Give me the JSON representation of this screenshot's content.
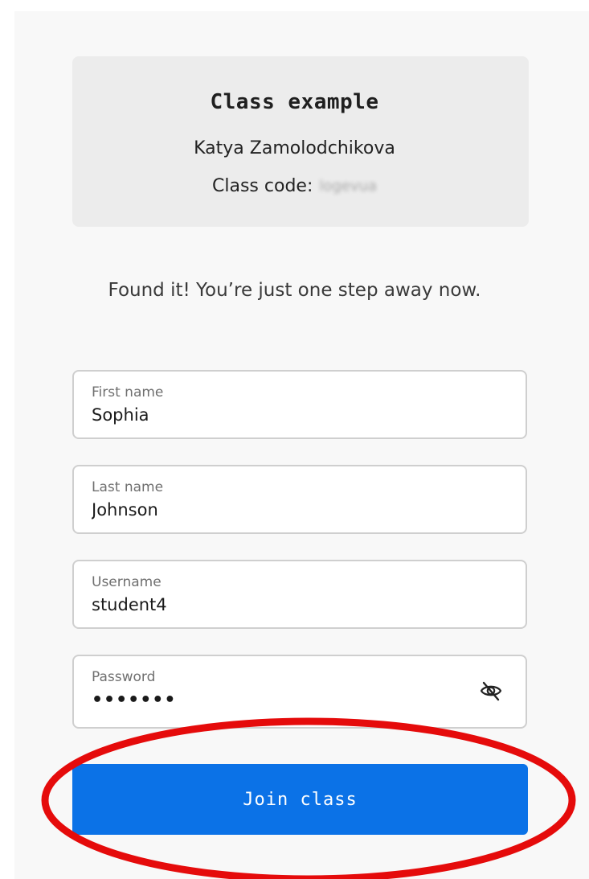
{
  "class_card": {
    "title": "Class example",
    "teacher": "Katya Zamolodchikova",
    "code_label": "Class code:",
    "code_value": "logevua"
  },
  "message": "Found it! You’re just one step away now.",
  "form": {
    "first_name": {
      "label": "First name",
      "value": "Sophia"
    },
    "last_name": {
      "label": "Last name",
      "value": "Johnson"
    },
    "username": {
      "label": "Username",
      "value": "student4"
    },
    "password": {
      "label": "Password",
      "masked": "•••••••",
      "toggle_icon": "eye-slash-icon"
    }
  },
  "join_button": {
    "label": "Join class",
    "color": "#0b72e7"
  },
  "annotation": {
    "color": "#e50b0b"
  }
}
